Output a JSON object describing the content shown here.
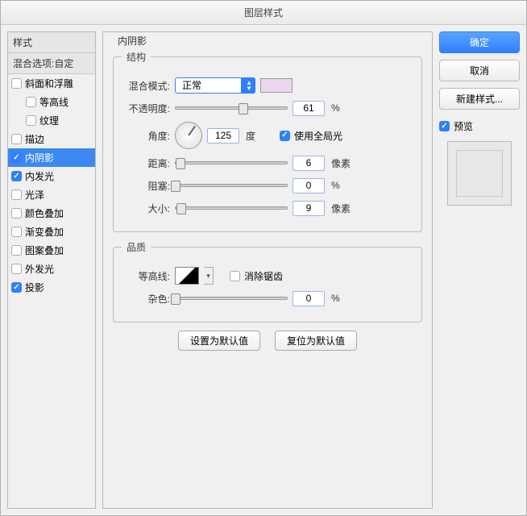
{
  "title": "图层样式",
  "sidebar": {
    "header1": "样式",
    "header2": "混合选项:自定",
    "items": [
      {
        "label": "斜面和浮雕",
        "checked": false
      },
      {
        "label": "等高线",
        "checked": false,
        "indent": true
      },
      {
        "label": "纹理",
        "checked": false,
        "indent": true
      },
      {
        "label": "描边",
        "checked": false
      },
      {
        "label": "内阴影",
        "checked": true,
        "selected": true
      },
      {
        "label": "内发光",
        "checked": true
      },
      {
        "label": "光泽",
        "checked": false
      },
      {
        "label": "颜色叠加",
        "checked": false
      },
      {
        "label": "渐变叠加",
        "checked": false
      },
      {
        "label": "图案叠加",
        "checked": false
      },
      {
        "label": "外发光",
        "checked": false
      },
      {
        "label": "投影",
        "checked": true
      }
    ]
  },
  "center": {
    "title": "内阴影",
    "structure_legend": "结构",
    "blend_mode": {
      "label": "混合模式:",
      "value": "正常",
      "swatch_color": "#ead7ee"
    },
    "opacity": {
      "label": "不透明度:",
      "value": "61",
      "unit": "%",
      "thumb_pct": 61
    },
    "angle": {
      "label": "角度:",
      "value": "125",
      "unit": "度",
      "global_label": "使用全局光",
      "global_checked": true
    },
    "distance": {
      "label": "距离:",
      "value": "6",
      "unit": "像素",
      "thumb_pct": 4
    },
    "choke": {
      "label": "阻塞:",
      "value": "0",
      "unit": "%",
      "thumb_pct": 0
    },
    "size": {
      "label": "大小:",
      "value": "9",
      "unit": "像素",
      "thumb_pct": 5
    },
    "quality_legend": "品质",
    "contour": {
      "label": "等高线:",
      "anti_alias_label": "消除锯齿",
      "anti_alias_checked": false
    },
    "noise": {
      "label": "杂色:",
      "value": "0",
      "unit": "%",
      "thumb_pct": 0
    },
    "default_btn": "设置为默认值",
    "reset_btn": "复位为默认值"
  },
  "right": {
    "ok": "确定",
    "cancel": "取消",
    "new_style": "新建样式...",
    "preview_label": "预览",
    "preview_checked": true
  }
}
